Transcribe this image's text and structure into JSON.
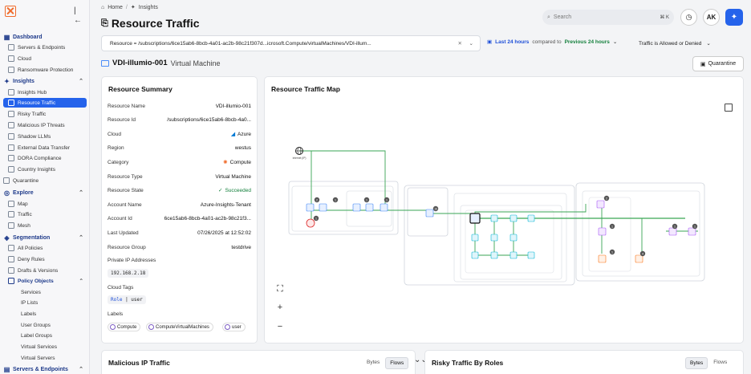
{
  "sidebar": {
    "sections": [
      {
        "label": "Dashboard",
        "items": [
          "Servers & Endpoints",
          "Cloud",
          "Ransomware Protection"
        ]
      },
      {
        "label": "Insights",
        "items": [
          "Insights Hub",
          "Resource Traffic",
          "Risky Traffic",
          "Malicious IP Threats",
          "Shadow LLMs",
          "External Data Transfer",
          "DORA Compliance",
          "Country Insights"
        ]
      },
      {
        "label": "Quarantine"
      },
      {
        "label": "Explore",
        "items": [
          "Map",
          "Traffic",
          "Mesh"
        ]
      },
      {
        "label": "Segmentation",
        "items": [
          "All Policies",
          "Deny Rules",
          "Drafts & Versions"
        ]
      },
      {
        "label": "Policy Objects",
        "items": [
          "Services",
          "IP Lists",
          "Labels",
          "User Groups",
          "Label Groups",
          "Virtual Services",
          "Virtual Servers"
        ]
      },
      {
        "label": "Servers & Endpoints"
      }
    ],
    "active_item": "Resource Traffic"
  },
  "header": {
    "breadcrumb": [
      "Home",
      "Insights"
    ],
    "title": "Resource Traffic",
    "search_placeholder": "Search",
    "search_shortcut": "⌘ K",
    "avatar_initials": "AK"
  },
  "filters": {
    "resource_label": "Resource",
    "resource_op": "=",
    "resource_value": "/subscriptions/6ce15ab6-8bcb-4a01-ac2b-98c21f307d...icrosoft.Compute/virtualMachines/VDI-illum...",
    "time_range": "Last 24 hours",
    "compared_to": "compared to",
    "compare_range": "Previous 24 hours",
    "traffic": "Traffic is Allowed or Denied"
  },
  "resource": {
    "name": "VDI-illumio-001",
    "kind": "Virtual Machine",
    "quarantine_label": "Quarantine"
  },
  "summary": {
    "title": "Resource Summary",
    "rows": [
      {
        "k": "Resource Name",
        "v": "VDI-illumio-001"
      },
      {
        "k": "Resource Id",
        "v": "/subscriptions/6ce15ab6-8bcb-4a0..."
      },
      {
        "k": "Cloud",
        "v": "Azure"
      },
      {
        "k": "Region",
        "v": "westus"
      },
      {
        "k": "Category",
        "v": "Compute"
      },
      {
        "k": "Resource Type",
        "v": "Virtual Machine"
      },
      {
        "k": "Resource State",
        "v": "Succeeded"
      },
      {
        "k": "Account Name",
        "v": "Azure-Insights-Tenant"
      },
      {
        "k": "Account Id",
        "v": "6ce15ab6-8bcb-4a01-ac2b-98c21f3..."
      },
      {
        "k": "Last Updated",
        "v": "07/26/2025 at 12:52:02"
      },
      {
        "k": "Resource Group",
        "v": "testdrive"
      }
    ],
    "private_ip_label": "Private IP Addresses",
    "private_ip": "192.168.2.18",
    "cloud_tags_label": "Cloud Tags",
    "cloud_tag_key": "Role",
    "cloud_tag_value": "user",
    "labels_label": "Labels",
    "labels": [
      "Compute",
      "ComputeVirtualMachines",
      "user"
    ]
  },
  "map": {
    "title": "Resource Traffic Map",
    "internet_label": "Internet (IP)",
    "badges": [
      "2",
      "1",
      "1",
      "1",
      "1",
      "16",
      "2",
      "1",
      "1",
      "1",
      "1",
      "4"
    ]
  },
  "malicious": {
    "title": "Malicious IP Traffic",
    "opt_bytes": "Bytes",
    "opt_flows": "Flows",
    "selected": "Flows"
  },
  "risky": {
    "title": "Risky Traffic By Roles",
    "opt_bytes": "Bytes",
    "opt_flows": "Flows",
    "selected": "Bytes"
  },
  "colors": {
    "accent": "#2563eb",
    "success": "#15803d",
    "brand": "#f06b2b"
  }
}
